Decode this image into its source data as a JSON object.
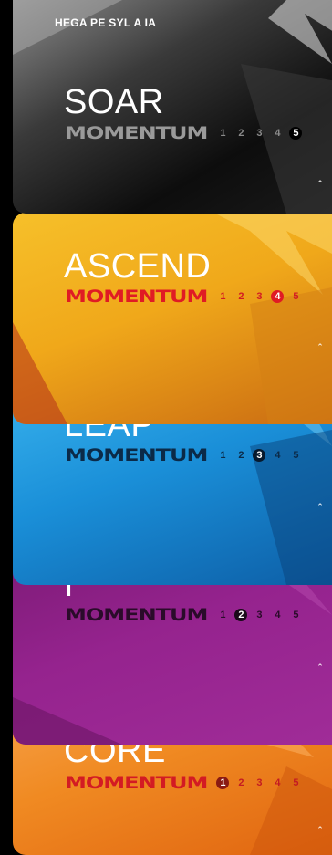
{
  "header": {
    "caption": "HEGA  PE   SYL A  IA"
  },
  "tabs": [
    {
      "level": "SOAR",
      "brand": "MOMENTUM",
      "numbers": [
        "1",
        "2",
        "3",
        "4",
        "5"
      ],
      "active": "5",
      "toggle": "⌃"
    },
    {
      "level": "ASCEND",
      "brand": "MOMENTUM",
      "numbers": [
        "1",
        "2",
        "3",
        "4",
        "5"
      ],
      "active": "4",
      "toggle": "⌃"
    },
    {
      "level": "LEAP",
      "brand": "MOMENTUM",
      "numbers": [
        "1",
        "2",
        "3",
        "4",
        "5"
      ],
      "active": "3",
      "toggle": "⌃"
    },
    {
      "level": "I",
      "brand": "MOMENTUM",
      "numbers": [
        "1",
        "2",
        "3",
        "4",
        "5"
      ],
      "active": "2",
      "toggle": "⌃"
    },
    {
      "level": "CORE",
      "brand": "MOMENTUM",
      "numbers": [
        "1",
        "2",
        "3",
        "4",
        "5"
      ],
      "active": "1",
      "toggle": "⌃"
    }
  ],
  "colors": {
    "soar": "#2a2a2a",
    "ascend": "#f0a81a",
    "leap": "#1a8fd8",
    "level2": "#95238e",
    "core": "#f07a1c",
    "soar_brand": "#9a9a9a",
    "ascend_brand": "#e01b24",
    "leap_brand": "#0b2a48",
    "level2_brand": "#2a0b2a",
    "core_brand": "#d31b23"
  }
}
